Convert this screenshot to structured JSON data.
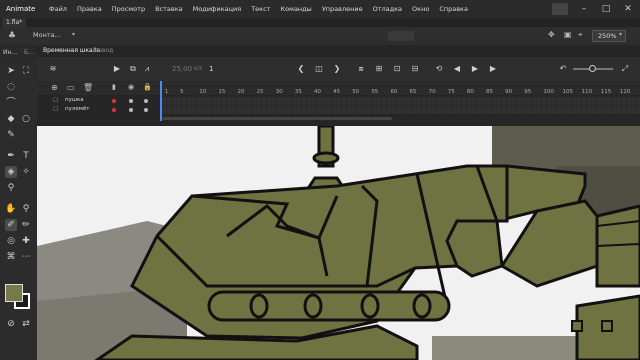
{
  "app": {
    "name": "Animate",
    "menu": [
      "Файл",
      "Правка",
      "Просмотр",
      "Вставка",
      "Модификация",
      "Текст",
      "Команды",
      "Управление",
      "Отладка",
      "Окно",
      "Справка"
    ]
  },
  "document": {
    "tab": "1.fla*"
  },
  "editbar": {
    "scene": "Монта...",
    "zoom": "250%"
  },
  "panels": {
    "tools_label": "Ин...",
    "tools_label2": "Б..."
  },
  "timeline": {
    "tab_active": "Временная шкала",
    "tab_inactive": "Вывод",
    "fps": "25,00",
    "fps_unit": "к/с",
    "frame": "1",
    "ruler": [
      "1",
      "5",
      "10",
      "15",
      "20",
      "25",
      "30",
      "35",
      "40",
      "45",
      "50",
      "55",
      "60",
      "65",
      "70",
      "75",
      "80",
      "85",
      "90",
      "95",
      "100",
      "105",
      "110",
      "115",
      "120"
    ],
    "layers": [
      {
        "name": "пушка"
      },
      {
        "name": "пулемёт"
      }
    ]
  },
  "colors": {
    "tank_body": "#6f7341",
    "outline": "#111111",
    "playhead": "#4a8df0"
  }
}
